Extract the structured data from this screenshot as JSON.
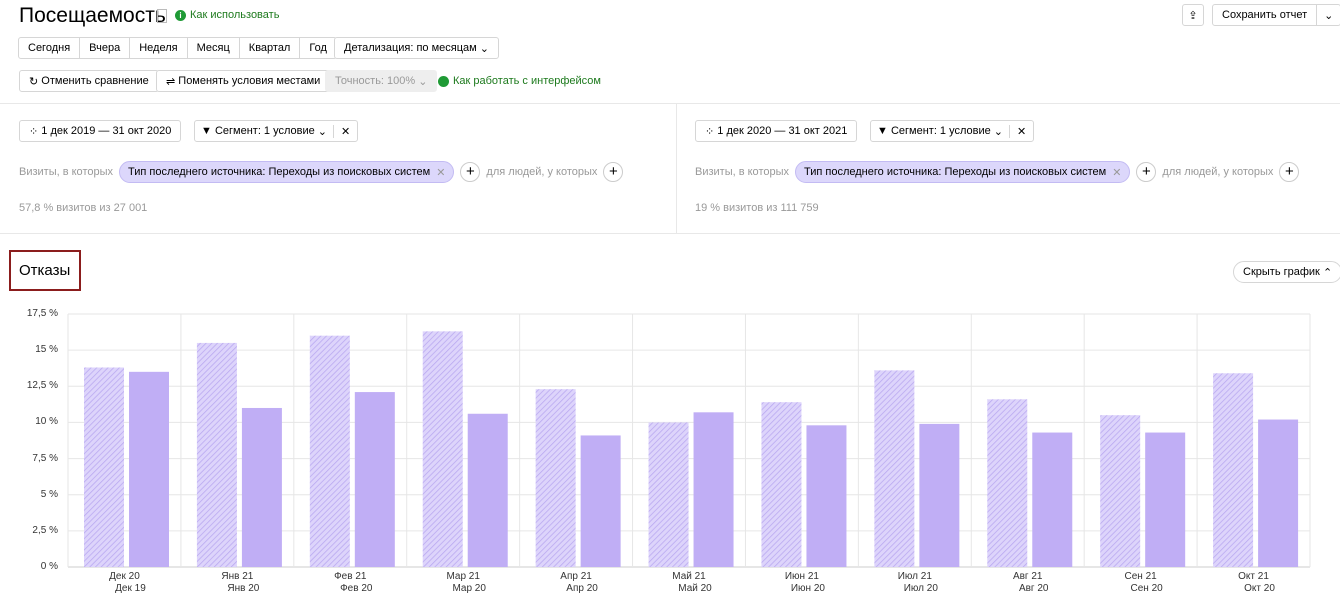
{
  "header": {
    "title": "Посещаемость",
    "howto": "Как использовать",
    "export_icon": "share-icon",
    "save": "Сохранить отчет"
  },
  "periods": [
    "Сегодня",
    "Вчера",
    "Неделя",
    "Месяц",
    "Квартал",
    "Год"
  ],
  "detail": "Детализация: по месяцам",
  "toolbar": {
    "cancel_compare": "Отменить сравнение",
    "swap": "Поменять условия местами",
    "accuracy": "Точность: 100%",
    "interface_help": "Как работать с интерфейсом"
  },
  "segments": [
    {
      "date": "1 дек 2019 — 31 окт 2020",
      "segment": "Сегмент: 1 условие",
      "visits_label": "Визиты, в которых",
      "chip": "Тип последнего источника: Переходы из поисковых систем",
      "people_label": "для людей, у которых",
      "stats": "57,8 % визитов из 27 001"
    },
    {
      "date": "1 дек 2020 — 31 окт 2021",
      "segment": "Сегмент: 1 условие",
      "visits_label": "Визиты, в которых",
      "chip": "Тип последнего источника: Переходы из поисковых систем",
      "people_label": "для людей, у которых",
      "stats": "19 % визитов из 111 759"
    }
  ],
  "chart_section": {
    "title": "Отказы",
    "hide": "Скрыть график"
  },
  "chart_data": {
    "type": "bar",
    "title": "Отказы",
    "ylim": [
      0,
      17.5
    ],
    "yticks": [
      "0 %",
      "2,5 %",
      "5 %",
      "7,5 %",
      "10 %",
      "12,5 %",
      "15 %",
      "17,5 %"
    ],
    "categories": [
      "Дек 20",
      "Янв 21",
      "Фев 21",
      "Мар 21",
      "Апр 21",
      "Май 21",
      "Июн 21",
      "Июл 21",
      "Авг 21",
      "Сен 21",
      "Окт 21"
    ],
    "categories2": [
      "Дек 19",
      "Янв 20",
      "Фев 20",
      "Мар 20",
      "Апр 20",
      "Май 20",
      "Июн 20",
      "Июл 20",
      "Авг 20",
      "Сен 20",
      "Окт 20"
    ],
    "series": [
      {
        "name": "hatched",
        "color": "#c4b5f5",
        "values": [
          13.8,
          15.5,
          16.0,
          16.3,
          12.3,
          10.0,
          11.4,
          13.6,
          11.6,
          10.5,
          13.4
        ]
      },
      {
        "name": "solid",
        "color": "#c0aef5",
        "values": [
          13.5,
          11.0,
          12.1,
          10.6,
          9.1,
          10.7,
          9.8,
          9.9,
          9.3,
          9.3,
          10.2
        ]
      }
    ],
    "grid": true
  }
}
